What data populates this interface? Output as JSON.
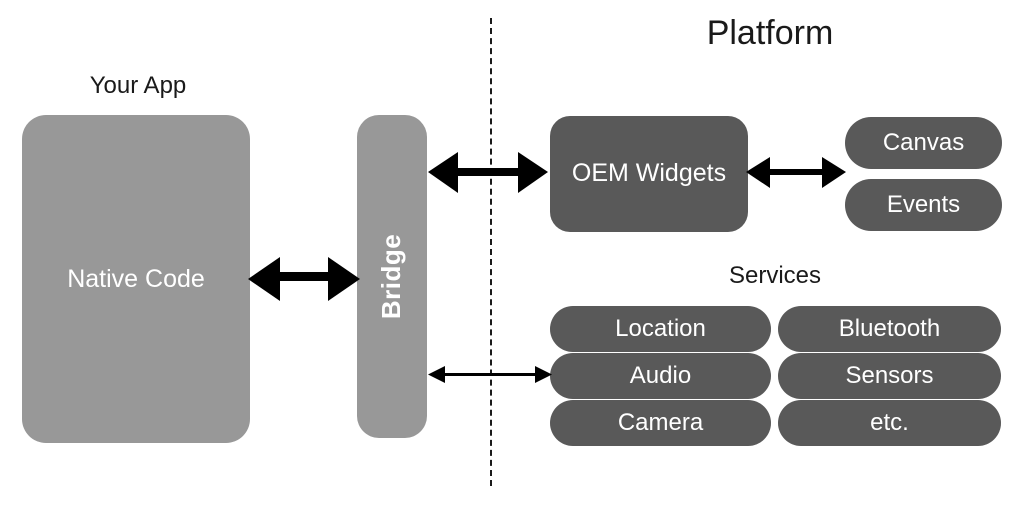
{
  "diagram": {
    "type": "architecture-diagram",
    "background_color": "#ffffff",
    "palette": {
      "light_gray": "#989898",
      "dark_gray": "#595959",
      "text_on_fill": "#ffffff",
      "text_on_bg": "#1a1a1a",
      "arrow": "#000000",
      "divider": "#1a1a1a"
    },
    "titles": {
      "platform": "Platform",
      "your_app": "Your App",
      "services": "Services"
    },
    "blocks": {
      "native_code": {
        "label": "Native Code",
        "fill": "#989898"
      },
      "bridge": {
        "label": "Bridge",
        "fill": "#989898",
        "rotated": true
      },
      "oem_widgets": {
        "label": "OEM Widgets",
        "fill": "#595959"
      }
    },
    "widget_pills": [
      {
        "label": "Canvas",
        "fill": "#595959"
      },
      {
        "label": "Events",
        "fill": "#595959"
      }
    ],
    "service_pills": [
      {
        "label": "Location",
        "fill": "#595959"
      },
      {
        "label": "Bluetooth",
        "fill": "#595959"
      },
      {
        "label": "Audio",
        "fill": "#595959"
      },
      {
        "label": "Sensors",
        "fill": "#595959"
      },
      {
        "label": "Camera",
        "fill": "#595959"
      },
      {
        "label": "etc.",
        "fill": "#595959"
      }
    ],
    "connections": [
      {
        "name": "native-code-to-bridge",
        "style": "double-arrow-thick"
      },
      {
        "name": "bridge-to-oem-widgets",
        "style": "double-arrow-thick"
      },
      {
        "name": "oem-widgets-to-canvas-events",
        "style": "double-arrow-medium"
      },
      {
        "name": "bridge-to-services",
        "style": "double-arrow-thin"
      }
    ],
    "divider": {
      "name": "platform-boundary",
      "style": "dashed-vertical"
    }
  }
}
